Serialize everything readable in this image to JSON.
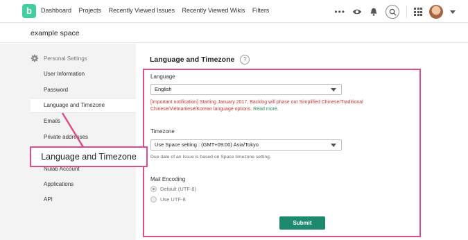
{
  "nav": {
    "logo_letter": "b",
    "items": [
      "Dashboard",
      "Projects",
      "Recently Viewed Issues",
      "Recently Viewed Wikis",
      "Filters"
    ],
    "more_label": "•••"
  },
  "space": {
    "name": "example space"
  },
  "sidebar": {
    "section_title": "Personal Settings",
    "items": [
      "User Information",
      "Password",
      "Language and Timezone",
      "Emails",
      "Private addresses",
      "Nulab Account",
      "Applications",
      "API"
    ],
    "active_index": 2
  },
  "main": {
    "title": "Language and Timezone",
    "help_label": "?",
    "language": {
      "label": "Language",
      "value": "English",
      "notice": "[Important notification] Starting January 2017, Backlog will phase out Simplified Chinese/Traditional Chinese/Vietnamese/Korean language options.",
      "notice_link": "Read more."
    },
    "timezone": {
      "label": "Timezone",
      "value": "Use Space setting : (GMT+09:00) Asia/Tokyo",
      "note": "Due date of an Issue is based on Space timezone setting."
    },
    "mail_encoding": {
      "label": "Mail Encoding",
      "options": [
        "Default (UTF-8)",
        "Use UTF-8"
      ],
      "selected_index": 0
    },
    "submit_label": "Submit"
  },
  "callout": {
    "text": "Language and Timezone"
  },
  "colors": {
    "brand": "#42ce9f",
    "highlight": "#e04b8a",
    "submit": "#1d8a6f",
    "notice": "#d0322f"
  }
}
